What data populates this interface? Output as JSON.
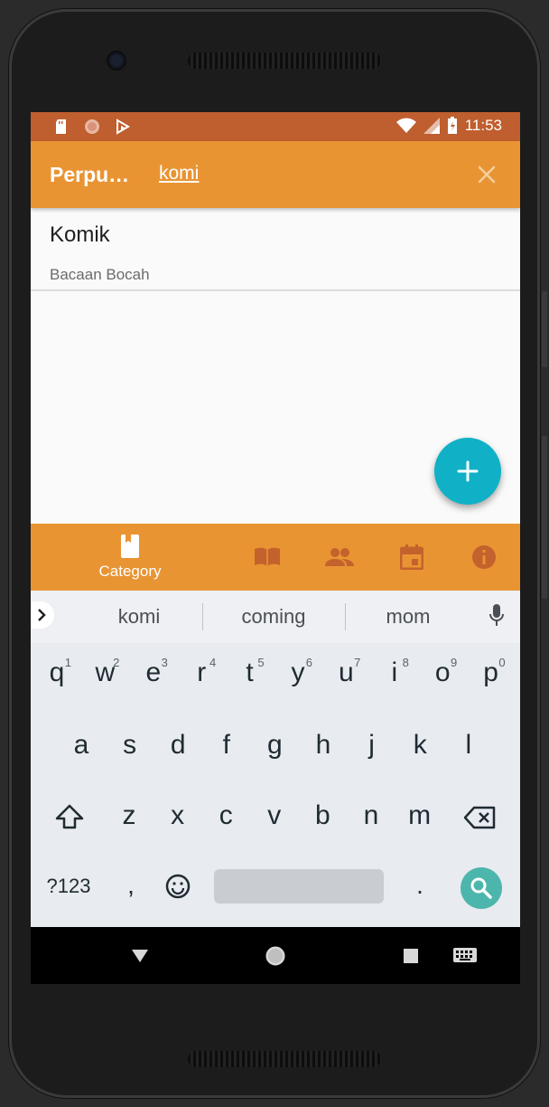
{
  "status_bar": {
    "time": "11:53"
  },
  "app_bar": {
    "title": "Perpu…",
    "search_query": "komi"
  },
  "results": [
    {
      "title": "Komik",
      "subtitle": "Bacaan Bocah"
    }
  ],
  "fab": {
    "icon": "plus"
  },
  "bottom_nav": {
    "active_label": "Category",
    "items": [
      {
        "icon": "category-book-icon",
        "label": "Category"
      },
      {
        "icon": "open-book-icon"
      },
      {
        "icon": "people-icon"
      },
      {
        "icon": "calendar-icon"
      },
      {
        "icon": "info-icon"
      }
    ]
  },
  "keyboard": {
    "suggestions": [
      "komi",
      "coming",
      "mom"
    ],
    "row1": [
      "q",
      "w",
      "e",
      "r",
      "t",
      "y",
      "u",
      "i",
      "o",
      "p"
    ],
    "row1_numbers": [
      "1",
      "2",
      "3",
      "4",
      "5",
      "6",
      "7",
      "8",
      "9",
      "0"
    ],
    "row2": [
      "a",
      "s",
      "d",
      "f",
      "g",
      "h",
      "j",
      "k",
      "l"
    ],
    "row3": [
      "z",
      "x",
      "c",
      "v",
      "b",
      "n",
      "m"
    ],
    "symbols_label": "?123",
    "comma": ",",
    "period": "."
  },
  "colors": {
    "accent": "#e99433",
    "status_bar": "#bf5e2f",
    "fab": "#10b1c6",
    "search_key": "#4db6ac"
  }
}
